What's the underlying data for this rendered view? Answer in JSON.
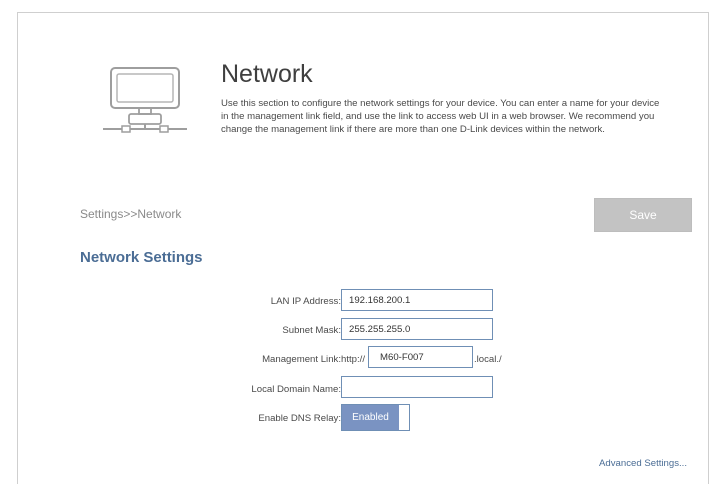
{
  "header": {
    "title": "Network",
    "description": "Use this section to configure the network settings for your device. You can enter a name for your device in the management link field, and use the link to access web UI in a web browser. We recommend you change the management link if there are more than one D-Link devices within the network."
  },
  "breadcrumb": "Settings>>Network",
  "toolbar": {
    "save_label": "Save"
  },
  "section": {
    "title": "Network Settings"
  },
  "form": {
    "lan_ip": {
      "label": "LAN IP Address:",
      "value": "192.168.200.1"
    },
    "subnet_mask": {
      "label": "Subnet Mask:",
      "value": "255.255.255.0"
    },
    "management_link": {
      "label": "Management Link:",
      "prefix": "http://",
      "value": "M60-F007",
      "suffix": ".local./"
    },
    "local_domain": {
      "label": "Local Domain Name:",
      "value": ""
    },
    "dns_relay": {
      "label": "Enable DNS Relay:",
      "state": "Enabled"
    }
  },
  "links": {
    "advanced_settings": "Advanced Settings..."
  },
  "icons": {
    "header_icon": "network-computer-icon"
  },
  "colors": {
    "accent": "#4b6d95",
    "toggle_on": "#7a93c2",
    "save_disabled": "#c3c3c3"
  }
}
